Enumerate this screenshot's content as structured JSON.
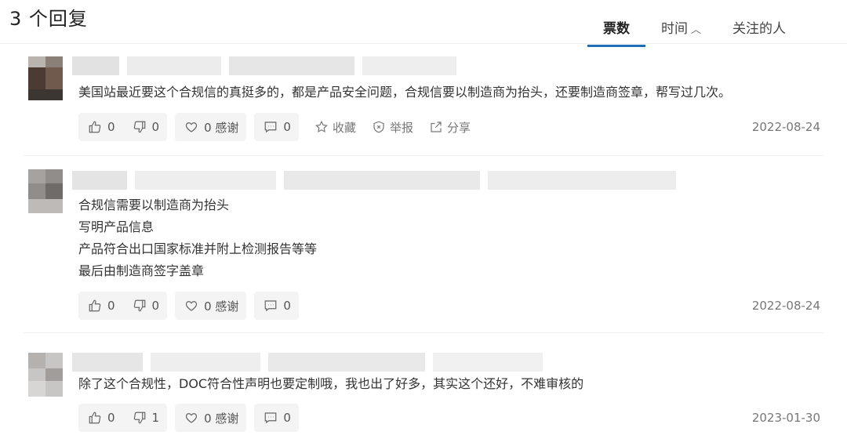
{
  "header": {
    "reply_count": "3 个回复",
    "tabs": [
      {
        "label": "票数",
        "active": true
      },
      {
        "label": "时间",
        "chevron": "^"
      },
      {
        "label": "关注的人"
      }
    ]
  },
  "replies": [
    {
      "lines": [
        "美国站最近要这个合规信的真挺多的，都是产品安全问题，合规信要以制造商为抬头，还要制造商签章，帮写过几次。"
      ],
      "like": "0",
      "dislike": "0",
      "thanks": "0 感谢",
      "comments": "0",
      "collect": "收藏",
      "report": "举报",
      "share": "分享",
      "date": "2022-08-24"
    },
    {
      "lines": [
        "合规信需要以制造商为抬头",
        "写明产品信息",
        "产品符合出口国家标准并附上检测报告等等",
        "最后由制造商签字盖章"
      ],
      "like": "0",
      "dislike": "0",
      "thanks": "0 感谢",
      "comments": "0",
      "date": "2022-08-24"
    },
    {
      "lines": [
        "除了这个合规性，DOC符合性声明也要定制哦，我也出了好多，其实这个还好，不难审核的"
      ],
      "like": "0",
      "dislike": "1",
      "thanks": "0 感谢",
      "comments": "0",
      "date": "2023-01-30"
    }
  ],
  "icons": [
    "thumbs-up-icon",
    "thumbs-down-icon",
    "heart-icon",
    "comment-icon",
    "star-icon",
    "report-icon",
    "share-icon"
  ],
  "colors": {
    "accent": "#1e6fb8",
    "button_bg": "#f4f4f4",
    "text": "#333333",
    "muted": "#777777"
  }
}
